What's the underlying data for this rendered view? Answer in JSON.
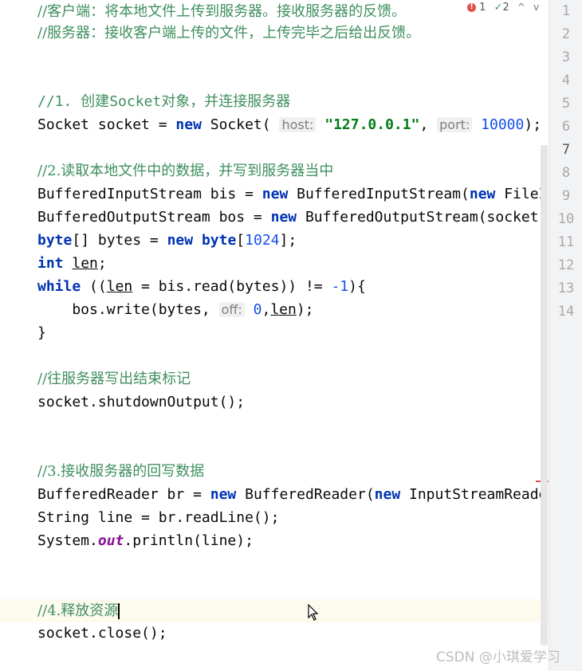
{
  "status": {
    "errors": "1",
    "checks": "2",
    "up_chevron": "^",
    "down_chevron": "v"
  },
  "gutter": {
    "line_numbers": [
      "1",
      "2",
      "3",
      "4",
      "5",
      "6",
      "7",
      "8",
      "9",
      "10",
      "11",
      "12",
      "13",
      "14"
    ]
  },
  "code": {
    "c1": "//客户端：将本地文件上传到服务器。接收服务器的反馈。",
    "c2": "//服务器：接收客户端上传的文件，上传完毕之后给出反馈。",
    "c3_a": "//1. 创建",
    "c3_b": "Socket",
    "c3_c": "对象，并连接服务器",
    "l_socket": {
      "a": "Socket socket = ",
      "kw": "new",
      "b": " Socket( ",
      "hint_host": "host:",
      "str": "\"127.0.0.1\"",
      "c": ", ",
      "hint_port": "port:",
      "num": "10000",
      "d": ");"
    },
    "c4": "//2.读取本地文件中的数据，并写到服务器当中",
    "l_bis": {
      "a": "BufferedInputStream bis = ",
      "kw": "new",
      "b": " BufferedInputStream(",
      "kw2": "new",
      "c": " FileI"
    },
    "l_bos": {
      "a": "BufferedOutputStream bos = ",
      "kw": "new",
      "b": " BufferedOutputStream(socket"
    },
    "l_bytes": {
      "kw": "byte",
      "a": "[] bytes = ",
      "kw2": "new",
      "b": " ",
      "kw3": "byte",
      "c": "[",
      "num": "1024",
      "d": "];"
    },
    "l_len": {
      "kw": "int",
      "a": " ",
      "var": "len",
      "b": ";"
    },
    "l_while": {
      "kw": "while",
      "a": " ((",
      "var": "len",
      "b": " = bis.read(bytes)) != ",
      "num": "-1",
      "c": "){"
    },
    "l_write": {
      "a": "    bos.write(bytes, ",
      "hint": "off:",
      "num": "0",
      "b": ",",
      "var": "len",
      "c": ");"
    },
    "l_close_brace": "}",
    "c5": "//往服务器写出结束标记",
    "l_shutdown": "socket.shutdownOutput();",
    "c6": "//3.接收服务器的回写数据",
    "l_br": {
      "a": "BufferedReader br = ",
      "kw": "new",
      "b": " BufferedReader(",
      "kw2": "new",
      "c": " InputStreamReade"
    },
    "l_line": "String line = br.readLine();",
    "l_print": {
      "a": "System.",
      "fld": "out",
      "b": ".println(line);"
    },
    "c7": "//4.释放资源",
    "l_close": "socket.close();"
  },
  "watermark": "CSDN @小琪爱学习"
}
